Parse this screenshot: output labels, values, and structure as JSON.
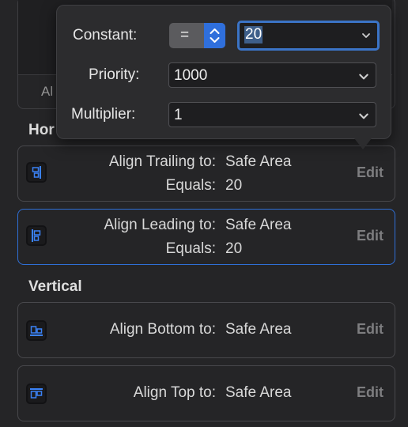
{
  "background": {
    "fragment_label": "Al"
  },
  "horizontal": {
    "title": "Horizontal",
    "visible_title_fragment": "Hor",
    "constraints": [
      {
        "attribute_label": "Align Trailing to:",
        "target": "Safe Area",
        "equals_label": "Equals:",
        "equals_value": "20",
        "edit_label": "Edit",
        "icon": "align-trailing-icon",
        "selected": false
      },
      {
        "attribute_label": "Align Leading to:",
        "target": "Safe Area",
        "equals_label": "Equals:",
        "equals_value": "20",
        "edit_label": "Edit",
        "icon": "align-leading-icon",
        "selected": true
      }
    ]
  },
  "vertical": {
    "title": "Vertical",
    "constraints": [
      {
        "attribute_label": "Align Bottom to:",
        "target": "Safe Area",
        "edit_label": "Edit",
        "icon": "align-bottom-icon"
      },
      {
        "attribute_label": "Align Top to:",
        "target": "Safe Area",
        "edit_label": "Edit",
        "icon": "align-top-icon"
      }
    ]
  },
  "popover": {
    "constant_label": "Constant:",
    "relation_value": "=",
    "constant_value": "20",
    "priority_label": "Priority:",
    "priority_value": "1000",
    "multiplier_label": "Multiplier:",
    "multiplier_value": "1"
  },
  "colors": {
    "accent": "#2f6fdc",
    "selected_border": "#2f6fd6",
    "icon_blue": "#3b82f6"
  }
}
